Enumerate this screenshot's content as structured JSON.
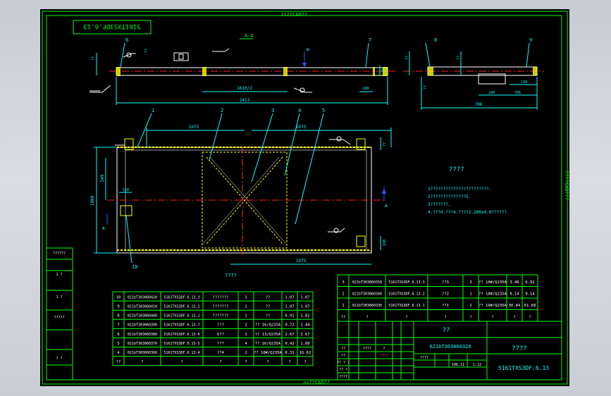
{
  "colors": {
    "background": "#000000",
    "frame": "#00ff00",
    "dim": "#00ffff",
    "centerline": "#ff2020",
    "part": "#ffff00",
    "white": "#ffffff",
    "blue": "#3050ff"
  },
  "border": {
    "top_label": "????CAD??",
    "bottom_label": "<<??CAD??",
    "right_label": "????CAD???"
  },
  "drawing_no_box": "5161TXS3DF.6.13",
  "views": {
    "section_label": "A-A",
    "arrow_label": "M",
    "section_total": "2413",
    "section_center": "1610/2",
    "dim_180": "180",
    "dim_35": "35",
    "detail_total": "706",
    "detail_240": "240",
    "detail_705": "705",
    "detail_130": "130",
    "plan_top_left": "1075",
    "plan_top_right": "1075",
    "plan_bottom": "1075",
    "plan_height": "1000",
    "plan_side": "549",
    "plan_small": "120",
    "plan_right_dim": "160",
    "arrow_A": "A",
    "balloons": [
      "1",
      "2",
      "3",
      "4",
      "5",
      "6",
      "7",
      "8",
      "9",
      "10"
    ],
    "plan_caption": "????"
  },
  "notes": {
    "title": "????",
    "lines": [
      "1???????????????????????.",
      "2??????????????5.",
      "3???????.",
      "4.???4.???4.????2-200x4.0??????."
    ]
  },
  "left_strip": [
    "??????",
    "1 ?",
    "1 ?",
    "?????",
    "? ?"
  ],
  "bom_left": [
    [
      "10",
      "021bT303060420",
      "5161TXS3DF.6.13.3",
      "???????",
      "1",
      "??",
      "1.07",
      "1.07"
    ],
    [
      "9",
      "021bT303060410",
      "5161TXS3DF.6.13.2",
      "???????",
      "1",
      "??",
      "1.07",
      "1.07"
    ],
    [
      "8",
      "021bT303060400",
      "5161TXS3DF.6.13.1",
      "???????",
      "1",
      "??",
      "0.91",
      "1.82"
    ],
    [
      "7",
      "021bT303060390",
      "5161TXS3DF.6.13-7",
      "???",
      "2",
      "?? 16/Q235A",
      "0.72",
      "1.44"
    ],
    [
      "6",
      "021bT303060380",
      "5161TXS3DF.6.13-6",
      "U??",
      "1",
      "?? 13/Q235A",
      "2.67",
      "2.67"
    ],
    [
      "5",
      "021bT303060370",
      "5161TXS3DF.6.13-5",
      "???",
      "4",
      "?? 16/Q235A",
      "0.42",
      "1.68"
    ],
    [
      "4",
      "021bT303060360",
      "5161TXS3DF.6.13-4",
      "??4",
      "2",
      "?? 10#/Q235A",
      "8.31",
      "16.62"
    ],
    [
      "??",
      "?",
      "?",
      "?",
      "?",
      "?",
      "?",
      "?"
    ]
  ],
  "bom_right": [
    [
      "3",
      "021bT303060350",
      "5161TXS3DF.6.13-3",
      "??3",
      "3",
      "?? 10#/Q235A",
      "3.46",
      "6.92"
    ],
    [
      "2",
      "021bT303060340",
      "5161TXS3DF.6.13-2",
      "??2",
      "1",
      "?? 10#/Q235A",
      "9.14",
      "9.14"
    ],
    [
      "1",
      "021bT303060330",
      "5161TXS3DF.6.13-1",
      "??1",
      "2",
      "?? 10#/Q235A",
      "30.84",
      "61.68"
    ],
    [
      "??",
      "?",
      "?",
      "?",
      "?",
      "?",
      "?",
      "?"
    ]
  ],
  "title_block": {
    "name": "??",
    "code": "021bT303060320",
    "center": "????",
    "drawing_no": "5161TXS3DF.6.13",
    "weight": "106.11",
    "scale": "1:12",
    "sign_cells": [
      "??",
      "????",
      "?",
      "??",
      "????",
      "?? ? ?",
      "?? ?",
      "????",
      "????"
    ]
  }
}
